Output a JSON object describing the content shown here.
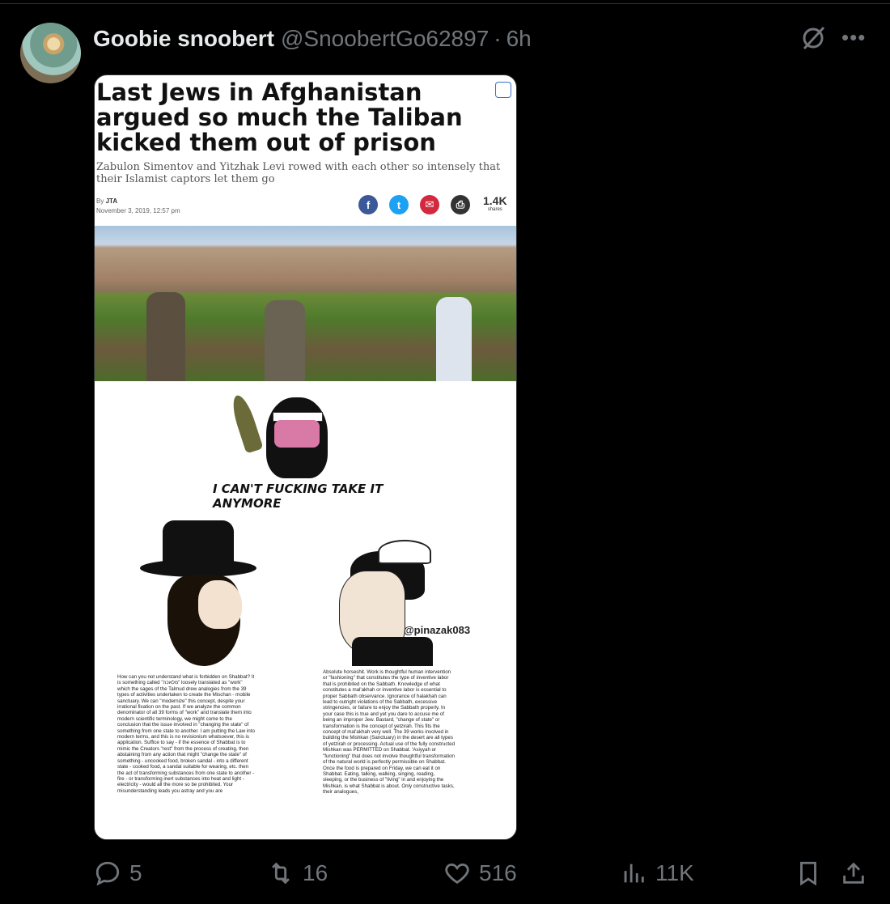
{
  "post": {
    "display_name": "Goobie snoobert",
    "handle": "@SnoobertGo62897",
    "separator": "·",
    "time": "6h"
  },
  "article": {
    "headline": "Last Jews in Afghanistan argued so much the Taliban kicked them out of prison",
    "subhead": "Zabulon Simentov and Yitzhak Levi rowed with each other so intensely that their Islamist captors let them go",
    "byline_prefix": "By",
    "byline_author": "JTA",
    "date": "November 3, 2019, 12:57 pm",
    "share_count": "1.4K",
    "share_label": "shares",
    "share_colors": [
      "#3b5998",
      "#1da1f2",
      "#d3293f",
      "#333333"
    ]
  },
  "meme": {
    "quote": "I CAN'T FUCKING TAKE IT ANYMORE",
    "watermark": "@pinazak083",
    "left_text": "How can you not understand what is forbidden on Shabbat? It is something called \"מלאכה\" loosely translated as \"work\" which the sages of the Talmud drew analogies from the 39 types of activities undertaken to create the Mischan - mobile sanctuary. We can \"modernize\" this concept, despite your irrational fixation on the past. If we analyze the common denominator of all 39 forms of \"work\" and translate them into modern scientific terminology, we might come to the conclusion that the issue involved in \"changing the state\" of something from one state to another. I am putting the Law into modern terms, and this is no revisionism whatsoever, this is application. Suffice to say - if the essence of Shabbat is to mimic the Creators \"rest\" from the process of creating, then abstaining from any action that might \"change the state\" of something - uncooked food, broken sandal - into a different state - cooked food, a sandal suitable for wearing, etc. then the act of transforming substances from one state to another - fire - or transforming inert substances into heat and light - electricity - would all the more so be prohibited. Your misunderstanding leads you astray and you are",
    "right_text": "Absolute horseshit. Work is thoughtful human intervention or \"fashioning\" that constitutes the type of inventive labor that is prohibited on the Sabbath. Knowledge of what constitutes a mal'akhah or inventive labor is essential to proper Sabbath observance. Ignorance of halakhah can lead to outright violations of the Sabbath, excessive stringencies, or failure to enjoy the Sabbath properly. In your case this is true and yet you dare to accuse me of being an improper Jew. Bastard, \"change of state\" or transformation is the concept of yetzirah. This fits the concept of mal'akhah very well. The 39 works involved in building the Mishkan (Sanctuary) in the desert are all types of yetzirah or processing. Actual use of the fully constructed Mishkan was PERMITTED on Shabbat. 'Asiyyah or \"functioning\" that does not involve thoughtful transformation of the natural world is perfectly permissible on Shabbat. Once the food is prepared on Friday, we can eat it on Shabbat. Eating, talking, walking, singing, reading, sleeping, or the business of \"living\" in and enjoying the Mishkan, is what Shabbat is about. Only constructive tasks, their analogues,"
  },
  "actions": {
    "replies": "5",
    "reposts": "16",
    "likes": "516",
    "views": "11K"
  },
  "icons": [
    "grok-icon",
    "more-icon",
    "reply-icon",
    "repost-icon",
    "like-icon",
    "views-icon",
    "bookmark-icon",
    "share-icon"
  ]
}
